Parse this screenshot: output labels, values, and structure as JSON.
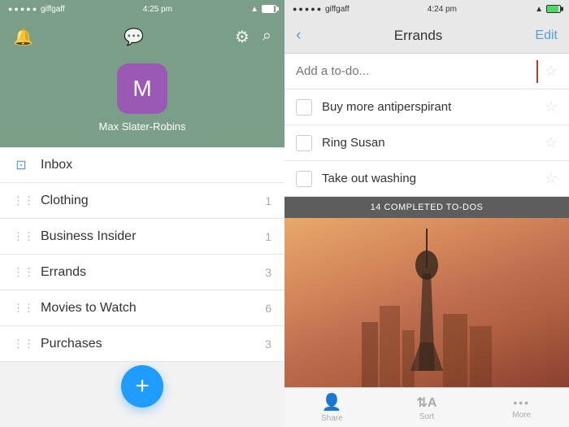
{
  "left": {
    "statusBar": {
      "dots": "●●●●●",
      "carrier": "giffgaff",
      "wifi": "WiFi",
      "time": "4:25 pm",
      "batteryLevel": 90
    },
    "navIcons": {
      "bell": "🔔",
      "chat": "💬",
      "settings": "⚙",
      "search": "🔍"
    },
    "profile": {
      "initial": "M",
      "name": "Max Slater-Robins"
    },
    "listItems": [
      {
        "id": "inbox",
        "label": "Inbox",
        "count": "",
        "iconType": "inbox"
      },
      {
        "id": "clothing",
        "label": "Clothing",
        "count": "1",
        "iconType": "grid"
      },
      {
        "id": "business-insider",
        "label": "Business Insider",
        "count": "1",
        "iconType": "grid"
      },
      {
        "id": "errands",
        "label": "Errands",
        "count": "3",
        "iconType": "grid"
      },
      {
        "id": "movies-to-watch",
        "label": "Movies to Watch",
        "count": "6",
        "iconType": "grid"
      },
      {
        "id": "purchases",
        "label": "Purchases",
        "count": "3",
        "iconType": "grid"
      }
    ],
    "fab": "+"
  },
  "right": {
    "statusBar": {
      "dots": "●●●●●",
      "carrier": "giffgaff",
      "wifi": "WiFi",
      "time": "4:24 pm",
      "batteryLevel": 85
    },
    "navBar": {
      "backLabel": "‹",
      "title": "Errands",
      "editLabel": "Edit"
    },
    "addPlaceholder": "Add a to-do...",
    "todos": [
      {
        "id": "todo-1",
        "text": "Buy more antiperspirant",
        "starred": false
      },
      {
        "id": "todo-2",
        "text": "Ring Susan",
        "starred": false
      },
      {
        "id": "todo-3",
        "text": "Take out washing",
        "starred": false
      }
    ],
    "completedBanner": "14 COMPLETED TO-DOS",
    "tabBar": [
      {
        "id": "share",
        "icon": "👤",
        "label": "Share"
      },
      {
        "id": "sort",
        "icon": "↕A",
        "label": "Sort"
      },
      {
        "id": "more",
        "icon": "•••",
        "label": "More"
      }
    ]
  }
}
